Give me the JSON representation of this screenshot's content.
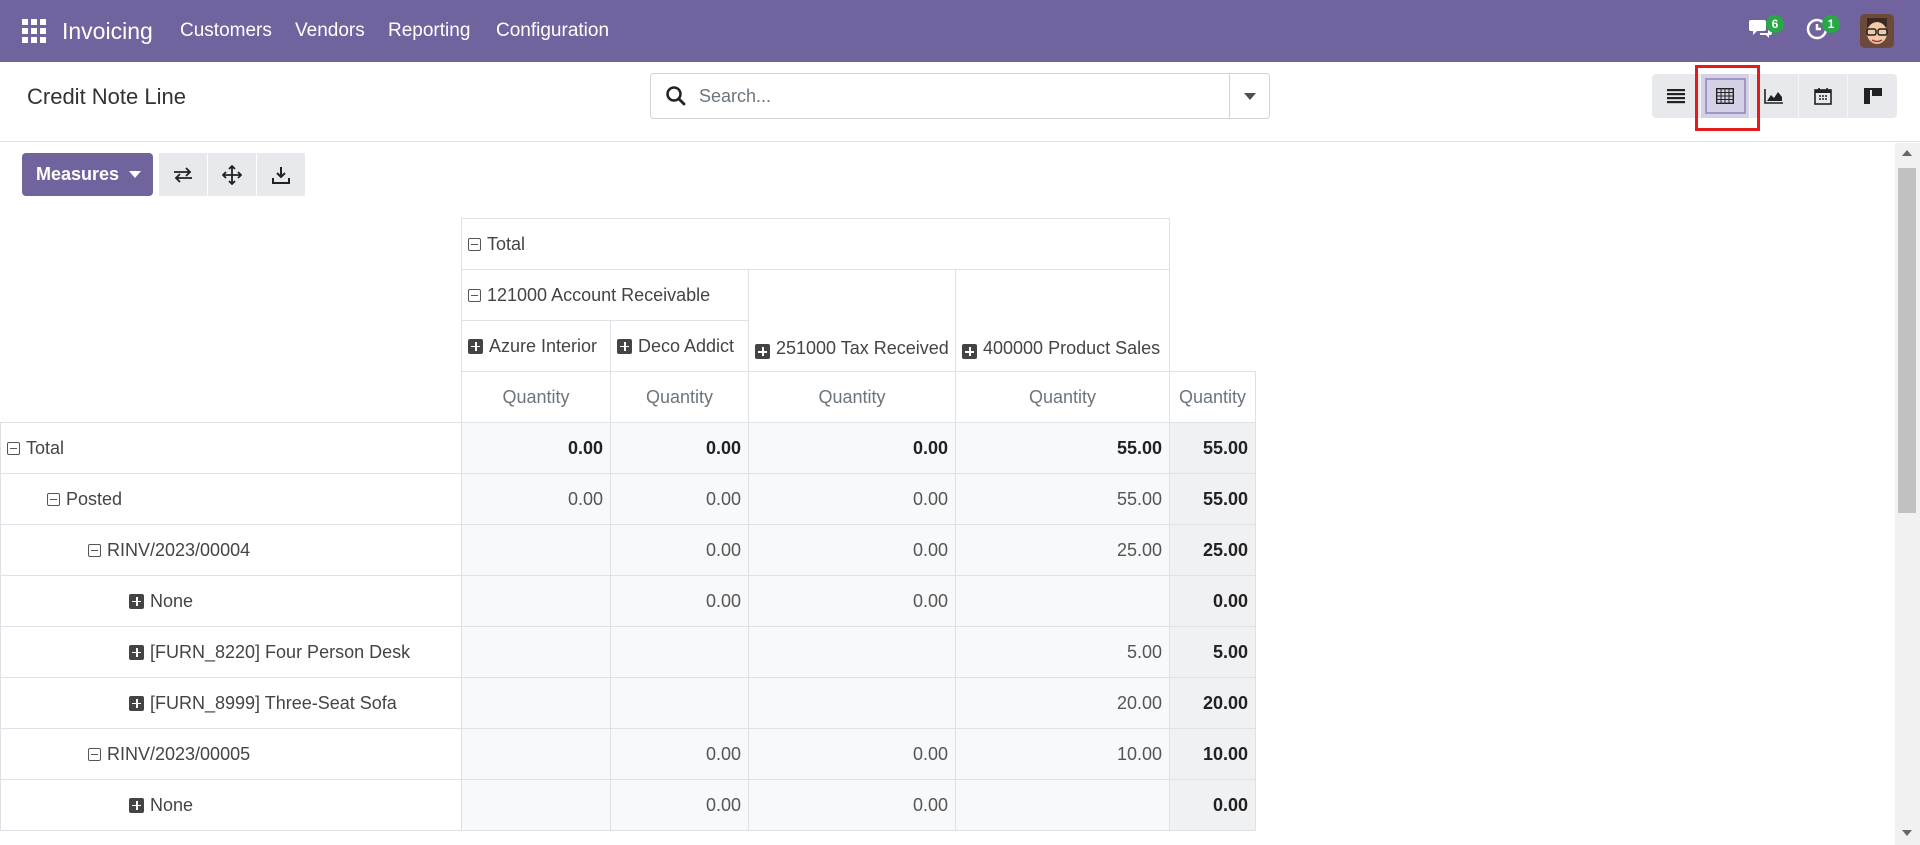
{
  "navbar": {
    "app_name": "Invoicing",
    "menu": [
      "Customers",
      "Vendors",
      "Reporting",
      "Configuration"
    ],
    "messages_count": "6",
    "activities_count": "1",
    "bg_color": "#71639e"
  },
  "control_panel": {
    "title": "Credit Note Line",
    "search_placeholder": "Search...",
    "views": [
      "list-view-icon",
      "pivot-view-icon",
      "graph-view-icon",
      "calendar-view-icon",
      "kanban-view-icon"
    ],
    "active_view": "pivot-view-icon"
  },
  "toolbar": {
    "measures_label": "Measures",
    "tools": [
      "flip-axis-icon",
      "expand-all-icon",
      "download-icon"
    ]
  },
  "pivot": {
    "col_total_label": "Total",
    "col_group_1": "121000 Account Receivable",
    "col_sub": [
      "Azure Interior",
      "Deco Addict"
    ],
    "col_group_2": "251000 Tax Received",
    "col_group_3": "400000 Product Sales",
    "measure_label": "Quantity",
    "rows": [
      {
        "label": "Total",
        "level": 0,
        "icon": "minus",
        "values": [
          "0.00",
          "0.00",
          "0.00",
          "55.00",
          "55.00"
        ],
        "bold": true
      },
      {
        "label": "Posted",
        "level": 1,
        "icon": "minus",
        "values": [
          "0.00",
          "0.00",
          "0.00",
          "55.00",
          "55.00"
        ],
        "bold": false
      },
      {
        "label": "RINV/2023/00004",
        "level": 2,
        "icon": "minus",
        "values": [
          "",
          "0.00",
          "0.00",
          "25.00",
          "25.00"
        ],
        "bold": false
      },
      {
        "label": "None",
        "level": 3,
        "icon": "plus",
        "values": [
          "",
          "0.00",
          "0.00",
          "",
          "0.00"
        ],
        "bold": false
      },
      {
        "label": "[FURN_8220] Four Person Desk",
        "level": 3,
        "icon": "plus",
        "values": [
          "",
          "",
          "",
          "5.00",
          "5.00"
        ],
        "bold": false
      },
      {
        "label": "[FURN_8999] Three-Seat Sofa",
        "level": 3,
        "icon": "plus",
        "values": [
          "",
          "",
          "",
          "20.00",
          "20.00"
        ],
        "bold": false
      },
      {
        "label": "RINV/2023/00005",
        "level": 2,
        "icon": "minus",
        "values": [
          "",
          "0.00",
          "0.00",
          "10.00",
          "10.00"
        ],
        "bold": false
      },
      {
        "label": "None",
        "level": 3,
        "icon": "plus",
        "values": [
          "",
          "0.00",
          "0.00",
          "",
          "0.00"
        ],
        "bold": false
      }
    ]
  }
}
